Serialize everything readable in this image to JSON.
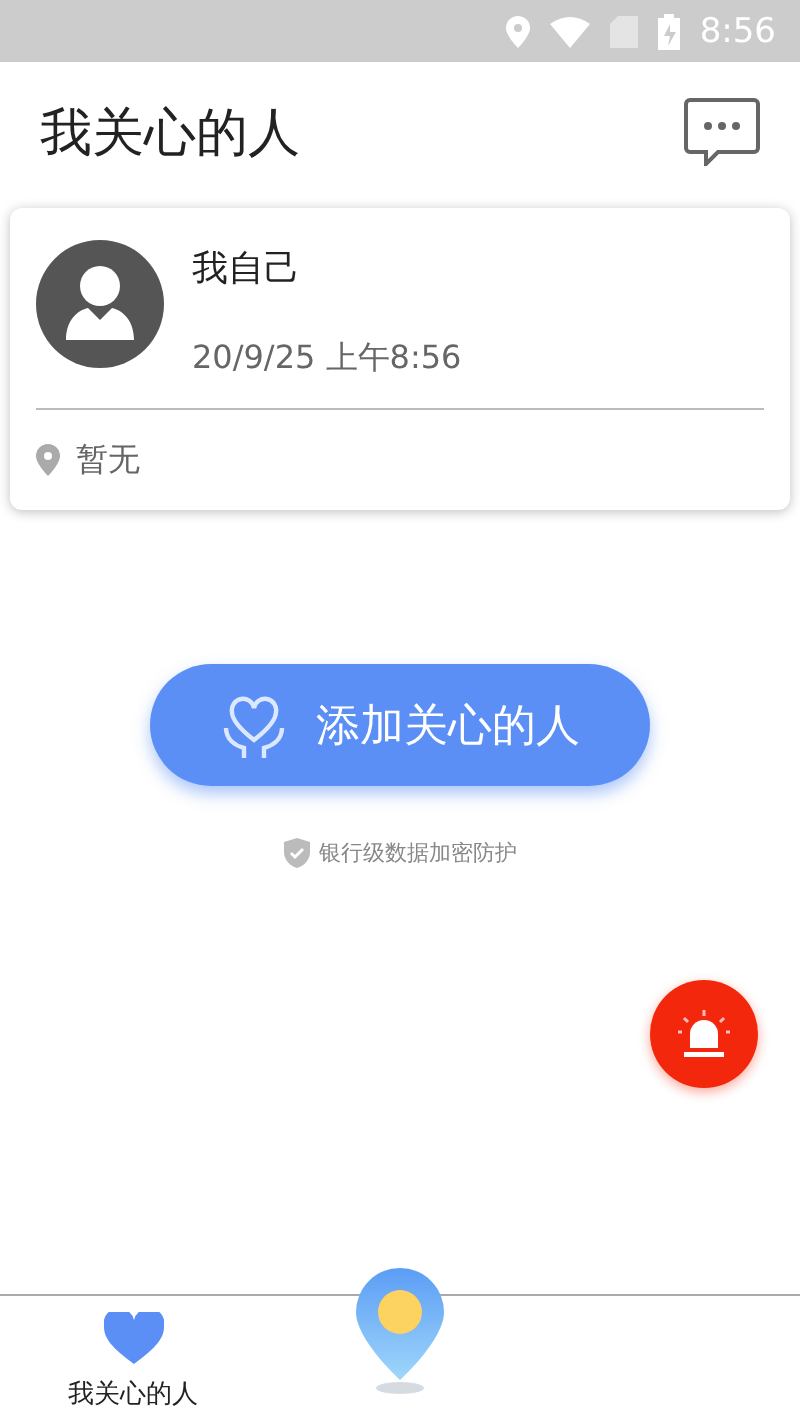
{
  "status_bar": {
    "time": "8:56"
  },
  "header": {
    "title": "我关心的人"
  },
  "people": [
    {
      "name": "我自己",
      "time": "20/9/25 上午8:56",
      "location": "暂无"
    }
  ],
  "add_button": {
    "label": "添加关心的人"
  },
  "security_note": "银行级数据加密防护",
  "tabs": [
    {
      "kind": "tab",
      "label": "我关心的人",
      "selected": true
    },
    {
      "kind": "center",
      "selected": false
    }
  ]
}
